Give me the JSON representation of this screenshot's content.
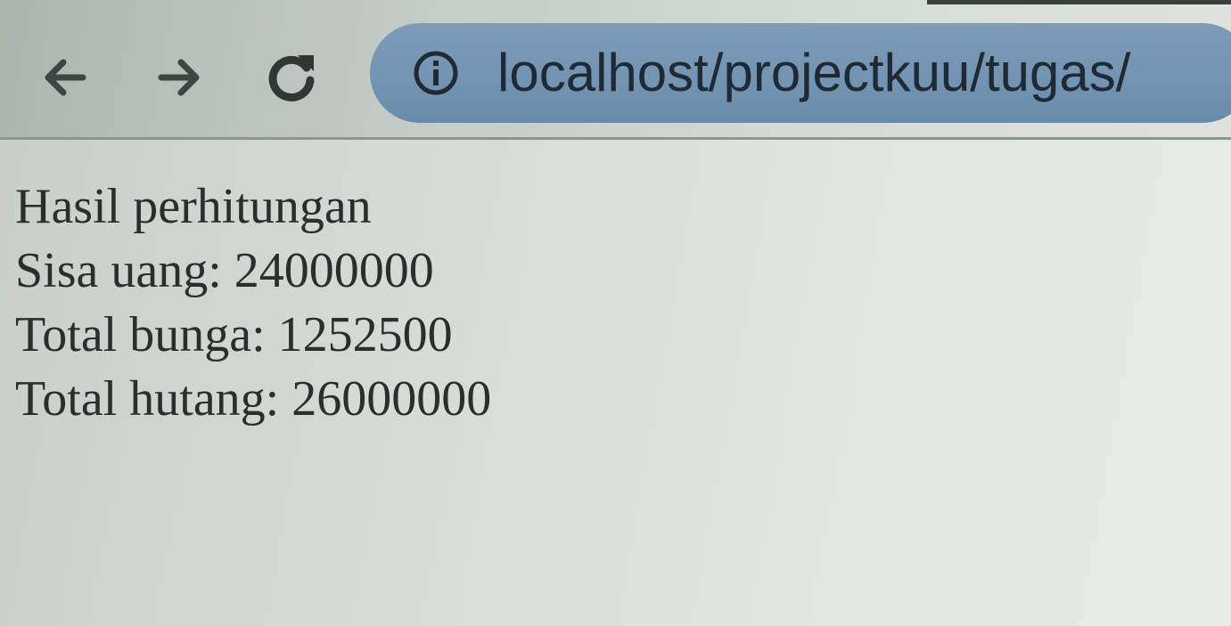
{
  "browser": {
    "url": "localhost/projectkuu/tugas/",
    "icons": {
      "back": "arrow-left-icon",
      "forward": "arrow-right-icon",
      "reload": "reload-icon",
      "site_info": "info-icon"
    }
  },
  "page": {
    "heading": "Hasil perhitungan",
    "results": [
      "Sisa uang: 24000000",
      "Total bunga: 1252500",
      "Total hutang: 26000000"
    ]
  }
}
